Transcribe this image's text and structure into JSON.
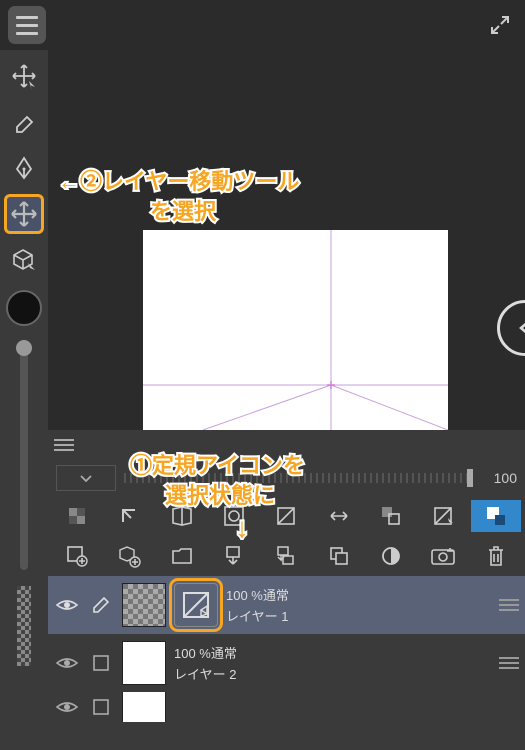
{
  "annotations": {
    "step2_line1": "←②レイヤー移動ツール",
    "step2_line2": "を選択",
    "step1_line1": "①定規アイコンを",
    "step1_line2": "選択状態に",
    "down_arrow": "↓"
  },
  "panel": {
    "opacity_value": "100",
    "layers": [
      {
        "blend": "100 %通常",
        "name": "レイヤー 1"
      },
      {
        "blend": "100 %通常",
        "name": "レイヤー 2"
      }
    ]
  },
  "icons": {
    "stroke": "#cccccc"
  }
}
